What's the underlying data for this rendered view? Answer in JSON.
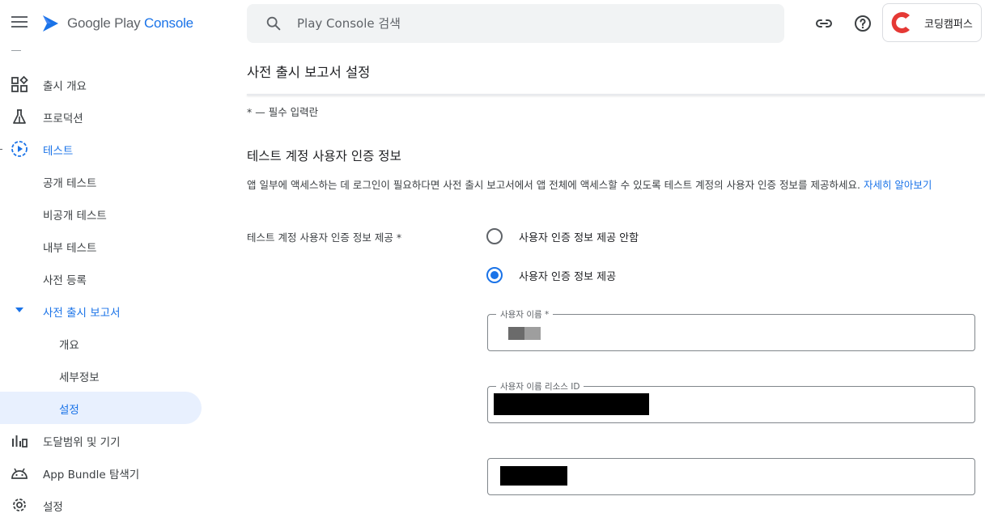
{
  "app": {
    "brand_prefix": "Google Play ",
    "brand_accent": "Console",
    "search_placeholder": "Play Console 검색",
    "account_name": "코딩캠퍼스"
  },
  "icons": {
    "menu": "hamburger-icon",
    "search": "search-icon",
    "link": "link-icon",
    "help": "help-icon"
  },
  "sidebar": {
    "items": [
      {
        "label": "출시 개요",
        "icon": "dashboard-icon"
      },
      {
        "label": "프로덕션",
        "icon": "production-icon"
      },
      {
        "label": "테스트",
        "icon": "testing-icon"
      },
      {
        "label": "공개 테스트"
      },
      {
        "label": "비공개 테스트"
      },
      {
        "label": "내부 테스트"
      },
      {
        "label": "사전 등록"
      },
      {
        "label": "사전 출시 보고서",
        "icon": "caret-down-icon"
      },
      {
        "label": "개요"
      },
      {
        "label": "세부정보"
      },
      {
        "label": "설정"
      },
      {
        "label": "도달범위 및 기기",
        "icon": "bar-chart-icon"
      },
      {
        "label": "App Bundle 탐색기",
        "icon": "android-icon"
      },
      {
        "label": "설정",
        "icon": "gear-icon"
      }
    ]
  },
  "main": {
    "page_title": "사전 출시 보고서 설정",
    "required_note": "* — 필수 입력란",
    "section_title": "테스트 계정 사용자 인증 정보",
    "section_desc": "앱 일부에 액세스하는 데 로그인이 필요하다면 사전 출시 보고서에서 앱 전체에 액세스할 수 있도록 테스트 계정의 사용자 인증 정보를 제공하세요. ",
    "learn_more": "자세히 알아보기",
    "field_label": "테스트 계정 사용자 인증 정보 제공  *",
    "radio_options": [
      {
        "label": "사용자 인증 정보 제공 안함",
        "checked": false
      },
      {
        "label": "사용자 인증 정보 제공",
        "checked": true
      }
    ],
    "username_label": "사용자 이름 *",
    "username_resource_label": "사용자 이름 리소스 ID"
  },
  "colors": {
    "accent": "#1a73e8",
    "selected_bg": "#e8f0fe",
    "search_bg": "#f1f3f4",
    "account_red": "#e53935"
  }
}
